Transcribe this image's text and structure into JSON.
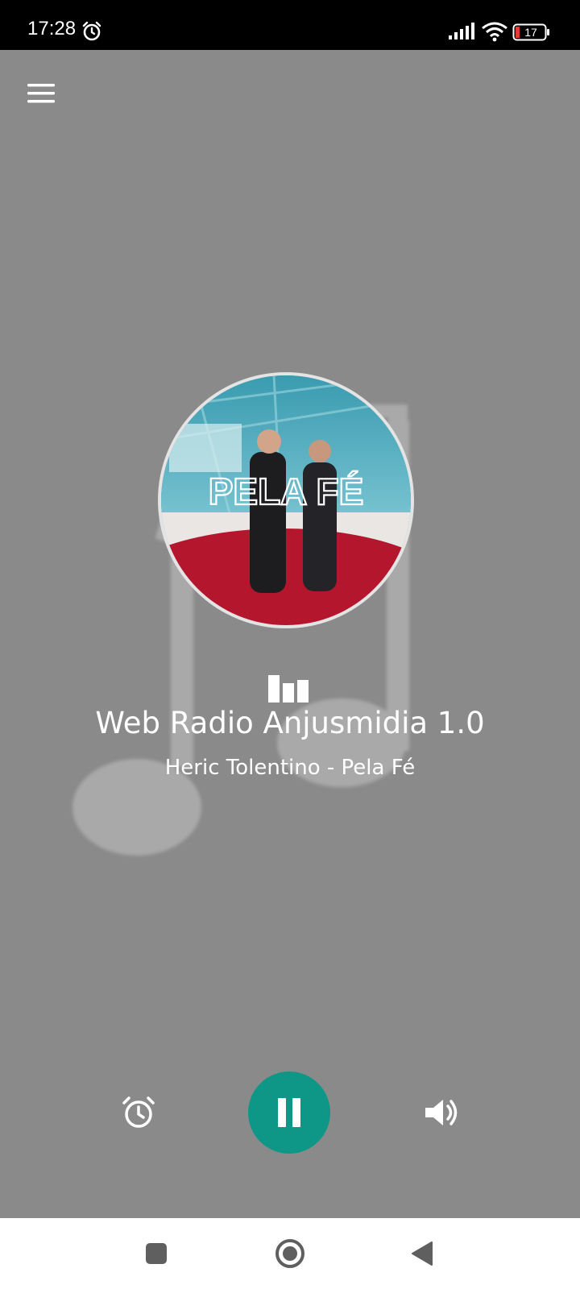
{
  "status_bar": {
    "time": "17:28",
    "battery_level": "17",
    "icons": [
      "alarm-icon",
      "signal-icon",
      "wifi-icon",
      "battery-icon"
    ]
  },
  "app": {
    "menu_icon": "hamburger-menu-icon",
    "cover_art_text": "PELA FÉ",
    "station_name": "Web Radio Anjusmidia 1.0",
    "track_info": "Heric Tolentino - Pela Fé",
    "equalizer_icon": "equalizer-bars-icon",
    "controls": {
      "alarm_icon": "alarm-clock-icon",
      "play_state_icon": "pause-icon",
      "volume_icon": "volume-icon"
    },
    "accent_color": "#0e9686",
    "background_color": "#8a8a8a"
  },
  "nav_bar": {
    "icons": [
      "recents-square-icon",
      "home-circle-icon",
      "back-triangle-icon"
    ]
  }
}
